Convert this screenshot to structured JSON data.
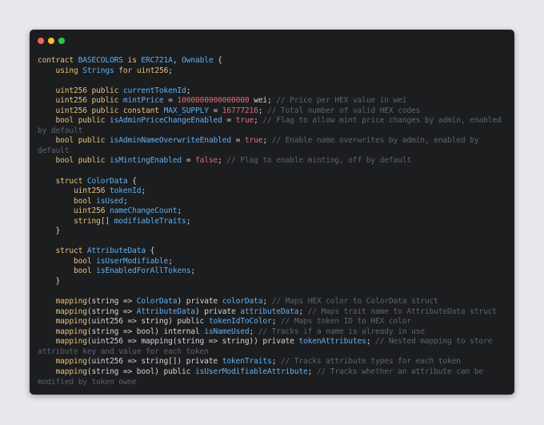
{
  "window": {
    "buttons": [
      "close",
      "minimize",
      "zoom"
    ],
    "colors": {
      "close": "#ff5f57",
      "minimize": "#febc2e",
      "zoom": "#28c840",
      "background": "#1c1d1f",
      "page_background": "#e7e9ec"
    }
  },
  "syntax_colors": {
    "keyword": "#e5c07b",
    "identifier": "#61afef",
    "literal": "#e06c75",
    "comment": "#5c6370",
    "plain": "#d4d4d4"
  },
  "code_lines": [
    [
      [
        "kw",
        "contract "
      ],
      [
        "ident",
        "BASECOLORS"
      ],
      [
        "kw",
        " is "
      ],
      [
        "ident",
        "ERC721A"
      ],
      [
        "plain",
        ", "
      ],
      [
        "ident",
        "Ownable"
      ],
      [
        "plain",
        " {"
      ]
    ],
    [
      [
        "plain",
        "    "
      ],
      [
        "kw",
        "using "
      ],
      [
        "ident",
        "Strings"
      ],
      [
        "kw",
        " for "
      ],
      [
        "ty",
        "uint256"
      ],
      [
        "plain",
        ";"
      ]
    ],
    [],
    [
      [
        "plain",
        "    "
      ],
      [
        "ty",
        "uint256"
      ],
      [
        "kw",
        " public "
      ],
      [
        "ident",
        "currentTokenId"
      ],
      [
        "plain",
        ";"
      ]
    ],
    [
      [
        "plain",
        "    "
      ],
      [
        "ty",
        "uint256"
      ],
      [
        "kw",
        " public "
      ],
      [
        "ident",
        "mintPrice"
      ],
      [
        "plain",
        " = "
      ],
      [
        "lit",
        "1000000000000000"
      ],
      [
        "plain",
        " wei; "
      ],
      [
        "cm",
        "// Price per HEX value in wei"
      ]
    ],
    [
      [
        "plain",
        "    "
      ],
      [
        "ty",
        "uint256"
      ],
      [
        "kw",
        " public constant "
      ],
      [
        "ident",
        "MAX_SUPPLY"
      ],
      [
        "plain",
        " = "
      ],
      [
        "lit",
        "16777216"
      ],
      [
        "plain",
        "; "
      ],
      [
        "cm",
        "// Total number of valid HEX codes"
      ]
    ],
    [
      [
        "plain",
        "    "
      ],
      [
        "ty",
        "bool"
      ],
      [
        "kw",
        " public "
      ],
      [
        "ident",
        "isAdminPriceChangeEnabled"
      ],
      [
        "plain",
        " = "
      ],
      [
        "lit",
        "true"
      ],
      [
        "plain",
        "; "
      ],
      [
        "cm",
        "// Flag to allow mint price changes by admin, enabled"
      ]
    ],
    [
      [
        "cm",
        "by default"
      ]
    ],
    [
      [
        "plain",
        "    "
      ],
      [
        "ty",
        "bool"
      ],
      [
        "kw",
        " public "
      ],
      [
        "ident",
        "isAdminNameOverwriteEnabled"
      ],
      [
        "plain",
        " = "
      ],
      [
        "lit",
        "true"
      ],
      [
        "plain",
        "; "
      ],
      [
        "cm",
        "// Enable name overwrites by admin, enabled by"
      ]
    ],
    [
      [
        "cm",
        "default"
      ]
    ],
    [
      [
        "plain",
        "    "
      ],
      [
        "ty",
        "bool"
      ],
      [
        "kw",
        " public "
      ],
      [
        "ident",
        "isMintingEnabled"
      ],
      [
        "plain",
        " = "
      ],
      [
        "lit",
        "false"
      ],
      [
        "plain",
        "; "
      ],
      [
        "cm",
        "// Flag to enable minting, off by default"
      ]
    ],
    [],
    [
      [
        "plain",
        "    "
      ],
      [
        "kw",
        "struct "
      ],
      [
        "ident",
        "ColorData"
      ],
      [
        "plain",
        " {"
      ]
    ],
    [
      [
        "plain",
        "        "
      ],
      [
        "ty",
        "uint256"
      ],
      [
        "plain",
        " "
      ],
      [
        "ident",
        "tokenId"
      ],
      [
        "plain",
        ";"
      ]
    ],
    [
      [
        "plain",
        "        "
      ],
      [
        "ty",
        "bool"
      ],
      [
        "plain",
        " "
      ],
      [
        "ident",
        "isUsed"
      ],
      [
        "plain",
        ";"
      ]
    ],
    [
      [
        "plain",
        "        "
      ],
      [
        "ty",
        "uint256"
      ],
      [
        "plain",
        " "
      ],
      [
        "ident",
        "nameChangeCount"
      ],
      [
        "plain",
        ";"
      ]
    ],
    [
      [
        "plain",
        "        "
      ],
      [
        "ty",
        "string[]"
      ],
      [
        "plain",
        " "
      ],
      [
        "ident",
        "modifiableTraits"
      ],
      [
        "plain",
        ";"
      ]
    ],
    [
      [
        "plain",
        "    }"
      ]
    ],
    [],
    [
      [
        "plain",
        "    "
      ],
      [
        "kw",
        "struct "
      ],
      [
        "ident",
        "AttributeData"
      ],
      [
        "plain",
        " {"
      ]
    ],
    [
      [
        "plain",
        "        "
      ],
      [
        "ty",
        "bool"
      ],
      [
        "plain",
        " "
      ],
      [
        "ident",
        "isUserModifiable"
      ],
      [
        "plain",
        ";"
      ]
    ],
    [
      [
        "plain",
        "        "
      ],
      [
        "ty",
        "bool"
      ],
      [
        "plain",
        " "
      ],
      [
        "ident",
        "isEnabledForAllTokens"
      ],
      [
        "plain",
        ";"
      ]
    ],
    [
      [
        "plain",
        "    }"
      ]
    ],
    [],
    [
      [
        "plain",
        "    "
      ],
      [
        "kw",
        "mapping"
      ],
      [
        "plain",
        "(string => "
      ],
      [
        "ident",
        "ColorData"
      ],
      [
        "plain",
        ") private "
      ],
      [
        "ident",
        "colorData"
      ],
      [
        "plain",
        "; "
      ],
      [
        "cm",
        "// Maps HEX color to ColorData struct"
      ]
    ],
    [
      [
        "plain",
        "    "
      ],
      [
        "kw",
        "mapping"
      ],
      [
        "plain",
        "(string => "
      ],
      [
        "ident",
        "AttributeData"
      ],
      [
        "plain",
        ") private "
      ],
      [
        "ident",
        "attributeData"
      ],
      [
        "plain",
        "; "
      ],
      [
        "cm",
        "// Maps trait name to AttributeData struct"
      ]
    ],
    [
      [
        "plain",
        "    "
      ],
      [
        "kw",
        "mapping"
      ],
      [
        "plain",
        "(uint256 => string) public "
      ],
      [
        "ident",
        "tokenIdToColor"
      ],
      [
        "plain",
        "; "
      ],
      [
        "cm",
        "// Maps token ID to HEX color"
      ]
    ],
    [
      [
        "plain",
        "    "
      ],
      [
        "kw",
        "mapping"
      ],
      [
        "plain",
        "(string => bool) internal "
      ],
      [
        "ident",
        "isNameUsed"
      ],
      [
        "plain",
        "; "
      ],
      [
        "cm",
        "// Tracks if a name is already in use"
      ]
    ],
    [
      [
        "plain",
        "    "
      ],
      [
        "kw",
        "mapping"
      ],
      [
        "plain",
        "(uint256 => mapping(string => string)) private "
      ],
      [
        "ident",
        "tokenAttributes"
      ],
      [
        "plain",
        "; "
      ],
      [
        "cm",
        "// Nested mapping to store"
      ]
    ],
    [
      [
        "cm",
        "attribute key and value for each token"
      ]
    ],
    [
      [
        "plain",
        "    "
      ],
      [
        "kw",
        "mapping"
      ],
      [
        "plain",
        "(uint256 => string[]) private "
      ],
      [
        "ident",
        "tokenTraits"
      ],
      [
        "plain",
        "; "
      ],
      [
        "cm",
        "// Tracks attribute types for each token"
      ]
    ],
    [
      [
        "plain",
        "    "
      ],
      [
        "kw",
        "mapping"
      ],
      [
        "plain",
        "(string => bool) public "
      ],
      [
        "ident",
        "isUserModifiableAttribute"
      ],
      [
        "plain",
        "; "
      ],
      [
        "cm",
        "// Tracks whether an attribute can be"
      ]
    ],
    [
      [
        "cm",
        "modified by token owne"
      ]
    ]
  ]
}
